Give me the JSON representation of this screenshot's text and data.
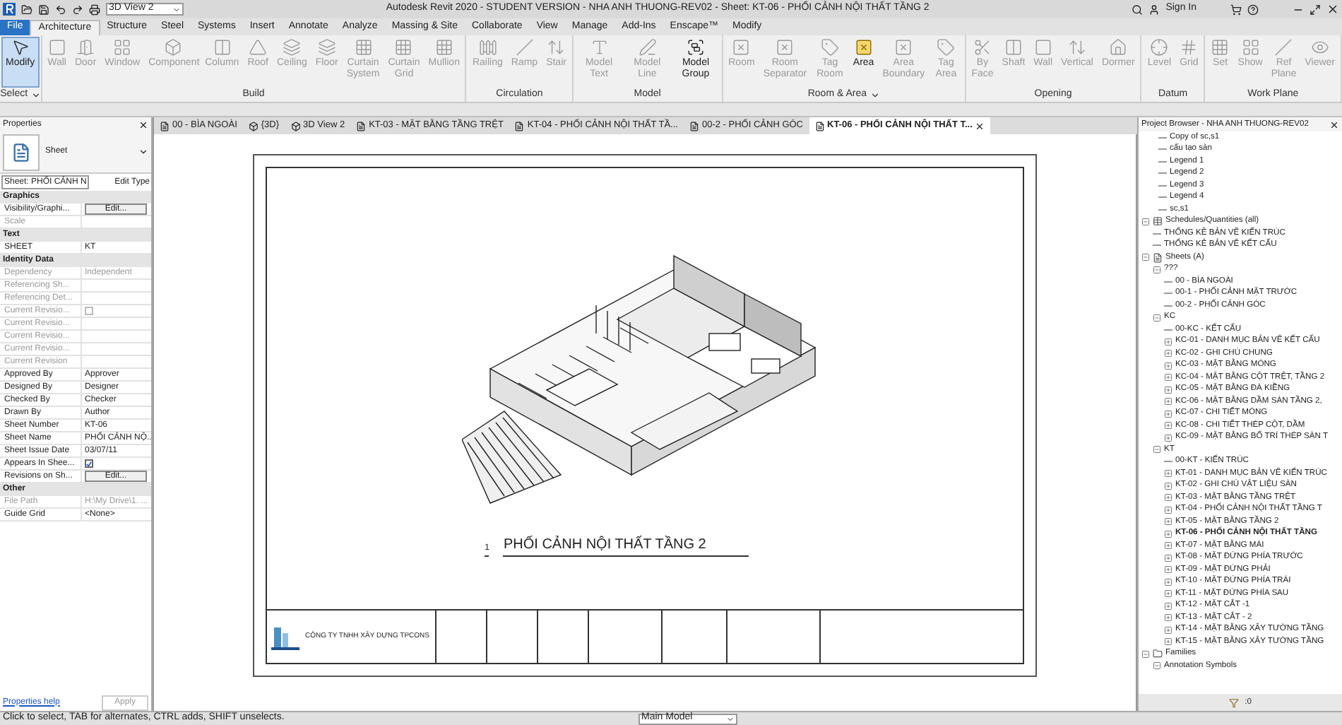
{
  "window": {
    "title": "Autodesk Revit 2020 - STUDENT VERSION - NHA ANH THUONG-REV02 - Sheet: KT-06 - PHỐI CẢNH NỘI THẤT TẦNG 2",
    "view_selector": "3D View 2",
    "sign_in": "Sign In"
  },
  "ribbon_tabs": [
    {
      "label": "File",
      "kind": "file",
      "selected": false
    },
    {
      "label": "Architecture",
      "kind": "tab",
      "selected": true
    },
    {
      "label": "Structure",
      "kind": "tab",
      "selected": false
    },
    {
      "label": "Steel",
      "kind": "tab",
      "selected": false
    },
    {
      "label": "Systems",
      "kind": "tab",
      "selected": false
    },
    {
      "label": "Insert",
      "kind": "tab",
      "selected": false
    },
    {
      "label": "Annotate",
      "kind": "tab",
      "selected": false
    },
    {
      "label": "Analyze",
      "kind": "tab",
      "selected": false
    },
    {
      "label": "Massing & Site",
      "kind": "tab",
      "selected": false
    },
    {
      "label": "Collaborate",
      "kind": "tab",
      "selected": false
    },
    {
      "label": "View",
      "kind": "tab",
      "selected": false
    },
    {
      "label": "Manage",
      "kind": "tab",
      "selected": false
    },
    {
      "label": "Add-Ins",
      "kind": "tab",
      "selected": false
    },
    {
      "label": "Enscape™",
      "kind": "tab",
      "selected": false
    },
    {
      "label": "Modify",
      "kind": "tab",
      "selected": false
    }
  ],
  "ribbon_panels": [
    {
      "title": "Select",
      "dropdown": true,
      "tools": [
        {
          "label": "Modify",
          "disabled": false,
          "selected": true
        }
      ]
    },
    {
      "title": "Build",
      "dropdown": false,
      "tools": [
        {
          "label": "Wall",
          "disabled": true,
          "selected": false
        },
        {
          "label": "Door",
          "disabled": true,
          "selected": false
        },
        {
          "label": "Window",
          "disabled": true,
          "selected": false
        },
        {
          "label": "Component",
          "disabled": true,
          "selected": false
        },
        {
          "label": "Column",
          "disabled": true,
          "selected": false
        },
        {
          "label": "Roof",
          "disabled": true,
          "selected": false
        },
        {
          "label": "Ceiling",
          "disabled": true,
          "selected": false
        },
        {
          "label": "Floor",
          "disabled": true,
          "selected": false
        },
        {
          "label": "Curtain System",
          "disabled": true,
          "selected": false
        },
        {
          "label": "Curtain Grid",
          "disabled": true,
          "selected": false
        },
        {
          "label": "Mullion",
          "disabled": true,
          "selected": false
        }
      ]
    },
    {
      "title": "Circulation",
      "dropdown": false,
      "tools": [
        {
          "label": "Railing",
          "disabled": true,
          "selected": false
        },
        {
          "label": "Ramp",
          "disabled": true,
          "selected": false
        },
        {
          "label": "Stair",
          "disabled": true,
          "selected": false
        }
      ]
    },
    {
      "title": "Model",
      "dropdown": false,
      "tools": [
        {
          "label": "Model Text",
          "disabled": true,
          "selected": false
        },
        {
          "label": "Model Line",
          "disabled": true,
          "selected": false
        },
        {
          "label": "Model Group",
          "disabled": false,
          "selected": false
        }
      ]
    },
    {
      "title": "Room & Area",
      "dropdown": true,
      "tools": [
        {
          "label": "Room",
          "disabled": true,
          "selected": false
        },
        {
          "label": "Room Separator",
          "disabled": true,
          "selected": false
        },
        {
          "label": "Tag Room",
          "disabled": true,
          "selected": false
        },
        {
          "label": "Area",
          "disabled": false,
          "selected": false
        },
        {
          "label": "Area Boundary",
          "disabled": true,
          "selected": false
        },
        {
          "label": "Tag Area",
          "disabled": true,
          "selected": false
        }
      ]
    },
    {
      "title": "Opening",
      "dropdown": false,
      "tools": [
        {
          "label": "By Face",
          "disabled": true,
          "selected": false
        },
        {
          "label": "Shaft",
          "disabled": true,
          "selected": false
        },
        {
          "label": "Wall",
          "disabled": true,
          "selected": false
        },
        {
          "label": "Vertical",
          "disabled": true,
          "selected": false
        },
        {
          "label": "Dormer",
          "disabled": true,
          "selected": false
        }
      ]
    },
    {
      "title": "Datum",
      "dropdown": false,
      "tools": [
        {
          "label": "Level",
          "disabled": true,
          "selected": false
        },
        {
          "label": "Grid",
          "disabled": true,
          "selected": false
        }
      ]
    },
    {
      "title": "Work Plane",
      "dropdown": false,
      "tools": [
        {
          "label": "Set",
          "disabled": true,
          "selected": false
        },
        {
          "label": "Show",
          "disabled": true,
          "selected": false
        },
        {
          "label": "Ref Plane",
          "disabled": true,
          "selected": false
        },
        {
          "label": "Viewer",
          "disabled": true,
          "selected": false
        }
      ]
    }
  ],
  "properties": {
    "title": "Properties",
    "type_name": "Sheet",
    "selector": "Sheet: PHỐI CẢNH N",
    "edit_type": "Edit Type",
    "sections": [
      {
        "title": "Graphics",
        "rows": [
          {
            "name": "Visibility/Graphi...",
            "value": "Edit...",
            "kind": "button",
            "disabled": false
          },
          {
            "name": "Scale",
            "kind": "text",
            "disabled": true
          }
        ]
      },
      {
        "title": "Text",
        "rows": [
          {
            "name": "SHEET",
            "value": "KT",
            "kind": "text",
            "disabled": false
          }
        ]
      },
      {
        "title": "Identity Data",
        "rows": [
          {
            "name": "Dependency",
            "value": "Independent",
            "kind": "text",
            "disabled": true
          },
          {
            "name": "Referencing Sh...",
            "kind": "text",
            "disabled": true
          },
          {
            "name": "Referencing Det...",
            "kind": "text",
            "disabled": true
          },
          {
            "name": "Current Revisio...",
            "kind": "checkbox",
            "checked": false,
            "disabled": true
          },
          {
            "name": "Current Revisio...",
            "kind": "text",
            "disabled": true
          },
          {
            "name": "Current Revisio...",
            "kind": "text",
            "disabled": true
          },
          {
            "name": "Current Revisio...",
            "kind": "text",
            "disabled": true
          },
          {
            "name": "Current Revision",
            "kind": "text",
            "disabled": true
          },
          {
            "name": "Approved By",
            "value": "Approver",
            "kind": "text",
            "disabled": false
          },
          {
            "name": "Designed By",
            "value": "Designer",
            "kind": "text",
            "disabled": false
          },
          {
            "name": "Checked By",
            "value": "Checker",
            "kind": "text",
            "disabled": false
          },
          {
            "name": "Drawn By",
            "value": "Author",
            "kind": "text",
            "disabled": false
          },
          {
            "name": "Sheet Number",
            "value": "KT-06",
            "kind": "text",
            "disabled": false
          },
          {
            "name": "Sheet Name",
            "value": "PHỐI CẢNH NỘ...",
            "kind": "text",
            "disabled": false
          },
          {
            "name": "Sheet Issue Date",
            "value": "03/07/11",
            "kind": "text",
            "disabled": false
          },
          {
            "name": "Appears In Shee...",
            "kind": "checkbox",
            "checked": true,
            "disabled": false
          },
          {
            "name": "Revisions on Sh...",
            "value": "Edit...",
            "kind": "button",
            "disabled": false
          }
        ]
      },
      {
        "title": "Other",
        "rows": [
          {
            "name": "File Path",
            "value": "H:\\My Drive\\1. ...",
            "kind": "text",
            "disabled": true
          },
          {
            "name": "Guide Grid",
            "value": "<None>",
            "kind": "text",
            "disabled": false
          }
        ]
      }
    ],
    "help_link": "Properties help",
    "apply": "Apply"
  },
  "view_tabs": [
    {
      "label": "00 - BÌA NGOÀI",
      "kind": "sheet",
      "selected": false
    },
    {
      "label": "{3D}",
      "kind": "model",
      "selected": false
    },
    {
      "label": "3D View 2",
      "kind": "model",
      "selected": false
    },
    {
      "label": "KT-03 - MẶT BẰNG TẦNG TRỆT",
      "kind": "sheet",
      "selected": false
    },
    {
      "label": "KT-04 - PHỐI CẢNH NỘI THẤT TẦ...",
      "kind": "sheet",
      "selected": false
    },
    {
      "label": "00-2 - PHỐI CẢNH GÓC",
      "kind": "sheet",
      "selected": false
    },
    {
      "label": "KT-06 - PHỐI CẢNH NỘI THẤT T...",
      "kind": "sheet",
      "selected": true
    }
  ],
  "sheet": {
    "view_number": "1",
    "view_title": "PHỐI CẢNH NỘI THẤT TẦNG 2",
    "company": "CÔNG TY TNHH XÂY DỰNG TPCONS"
  },
  "browser": {
    "title": "Project Browser - NHA ANH THUONG-REV02",
    "continued_items": [
      {
        "label": "Copy of sc,s1",
        "selected": false
      },
      {
        "label": "cấu tạo sàn",
        "selected": false
      },
      {
        "label": "Legend 1",
        "selected": false
      },
      {
        "label": "Legend 2",
        "selected": false
      },
      {
        "label": "Legend 3",
        "selected": false
      },
      {
        "label": "Legend 4",
        "selected": false
      },
      {
        "label": "sc,s1",
        "selected": false
      }
    ],
    "tree": [
      {
        "label": "Schedules/Quantities (all)",
        "kind": "schedules",
        "expanded": true,
        "selected": false,
        "children": [
          {
            "label": "THỐNG KÊ BẢN VẼ KIẾN TRÚC",
            "selected": false
          },
          {
            "label": "THỐNG KÊ BẢN VẼ KẾT CẤU",
            "selected": false
          }
        ]
      },
      {
        "label": "Sheets (A)",
        "kind": "sheets",
        "expanded": true,
        "selected": false,
        "children": [
          {
            "label": "???",
            "expanded": true,
            "selected": false,
            "children": [
              {
                "label": "00 - BÌA NGOÀI",
                "selected": false
              },
              {
                "label": "00-1 - PHỐI CẢNH MẶT TRƯỚC",
                "selected": false
              },
              {
                "label": "00-2 - PHỐI CẢNH GÓC",
                "selected": false
              }
            ]
          },
          {
            "label": "KC",
            "expanded": true,
            "selected": false,
            "children": [
              {
                "label": "00-KC - KẾT CẤU",
                "selected": false
              },
              {
                "label": "KC-01 - DANH MỤC BẢN VẼ KẾT CẤU",
                "expanded": false,
                "selected": false
              },
              {
                "label": "KC-02 - GHI CHÚ CHUNG",
                "expanded": false,
                "selected": false
              },
              {
                "label": "KC-03 - MẶT BẰNG MÓNG",
                "expanded": false,
                "selected": false
              },
              {
                "label": "KC-04 - MẶT BẰNG CỘT TRỆT, TẦNG 2",
                "expanded": false,
                "selected": false
              },
              {
                "label": "KC-05 - MẶT BẰNG ĐÀ KIỀNG",
                "expanded": false,
                "selected": false
              },
              {
                "label": "KC-06 - MẶT BẰNG DẦM SÀN TẦNG 2,",
                "expanded": false,
                "selected": false
              },
              {
                "label": "KC-07 - CHI TIẾT MÓNG",
                "expanded": false,
                "selected": false
              },
              {
                "label": "KC-08 - CHI TIẾT THÉP CỘT, DẦM",
                "expanded": false,
                "selected": false
              },
              {
                "label": "KC-09 - MẶT BẰNG BỐ TRÍ THÉP SÀN T",
                "expanded": false,
                "selected": false
              }
            ]
          },
          {
            "label": "KT",
            "expanded": true,
            "selected": false,
            "children": [
              {
                "label": "00-KT - KIẾN TRÚC",
                "selected": false
              },
              {
                "label": "KT-01 - DANH MỤC BẢN VẼ KIẾN TRÚC",
                "expanded": false,
                "selected": false
              },
              {
                "label": "KT-02 - GHI CHÚ VẬT LIỆU SÀN",
                "expanded": false,
                "selected": false
              },
              {
                "label": "KT-03 - MẶT BẰNG TẦNG TRỆT",
                "expanded": false,
                "selected": false
              },
              {
                "label": "KT-04 - PHỐI CẢNH NỘI THẤT TẦNG T",
                "expanded": false,
                "selected": false
              },
              {
                "label": "KT-05 - MẶT BẰNG TẦNG 2",
                "expanded": false,
                "selected": false
              },
              {
                "label": "KT-06 - PHỐI CẢNH NỘI THẤT TẦNG",
                "expanded": false,
                "selected": true
              },
              {
                "label": "KT-07 - MẶT BẰNG MÁI",
                "expanded": false,
                "selected": false
              },
              {
                "label": "KT-08 - MẶT ĐỨNG PHÍA TRƯỚC",
                "expanded": false,
                "selected": false
              },
              {
                "label": "KT-09 - MẶT ĐỨNG PHẢI",
                "expanded": false,
                "selected": false
              },
              {
                "label": "KT-10 - MẶT ĐỨNG PHÍA TRÁI",
                "expanded": false,
                "selected": false
              },
              {
                "label": "KT-11 - MẶT ĐỨNG PHÍA SAU",
                "expanded": false,
                "selected": false
              },
              {
                "label": "KT-12 - MẶT CẮT -1",
                "expanded": false,
                "selected": false
              },
              {
                "label": "KT-13 - MẶT CẮT - 2",
                "expanded": false,
                "selected": false
              },
              {
                "label": "KT-14 - MẶT BẰNG XÂY TƯỜNG TẦNG",
                "expanded": false,
                "selected": false
              },
              {
                "label": "KT-15 - MẶT BẰNG XÂY TƯỜNG TẦNG",
                "expanded": false,
                "selected": false
              }
            ]
          }
        ]
      },
      {
        "label": "Families",
        "kind": "families",
        "expanded": true,
        "selected": false,
        "children": [
          {
            "label": "Annotation Symbols",
            "expanded": true,
            "selected": false
          }
        ]
      }
    ]
  },
  "status_bar": {
    "hint": "Click to select, TAB for alternates, CTRL adds, SHIFT unselects.",
    "filter_count": ":0",
    "model": "Main Model"
  }
}
